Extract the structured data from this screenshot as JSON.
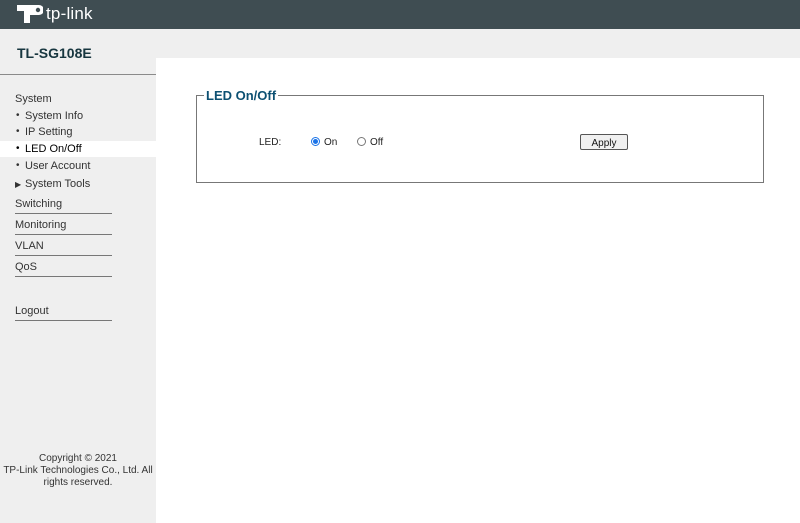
{
  "brand": {
    "logo_text": "tp-link",
    "model": "TL-SG108E"
  },
  "sidebar": {
    "system_label": "System",
    "system_items": [
      {
        "label": "System Info",
        "active": false
      },
      {
        "label": "IP Setting",
        "active": false
      },
      {
        "label": "LED On/Off",
        "active": true
      },
      {
        "label": "User Account",
        "active": false
      },
      {
        "label": "System Tools",
        "active": false,
        "expandable": true
      }
    ],
    "sections": [
      "Switching",
      "Monitoring",
      "VLAN",
      "QoS"
    ],
    "logout": "Logout",
    "copyright": [
      "Copyright © 2021",
      "TP-Link Technologies Co., Ltd. All",
      "rights reserved."
    ]
  },
  "main": {
    "panel_title": "LED On/Off",
    "led_label": "LED:",
    "options": [
      {
        "label": "On",
        "selected": true
      },
      {
        "label": "Off",
        "selected": false
      }
    ],
    "apply_label": "Apply"
  },
  "colors": {
    "topbar": "#3f4d52",
    "sidebar": "#efefef",
    "legend": "#0c5072",
    "radio": "#1a73e8"
  }
}
